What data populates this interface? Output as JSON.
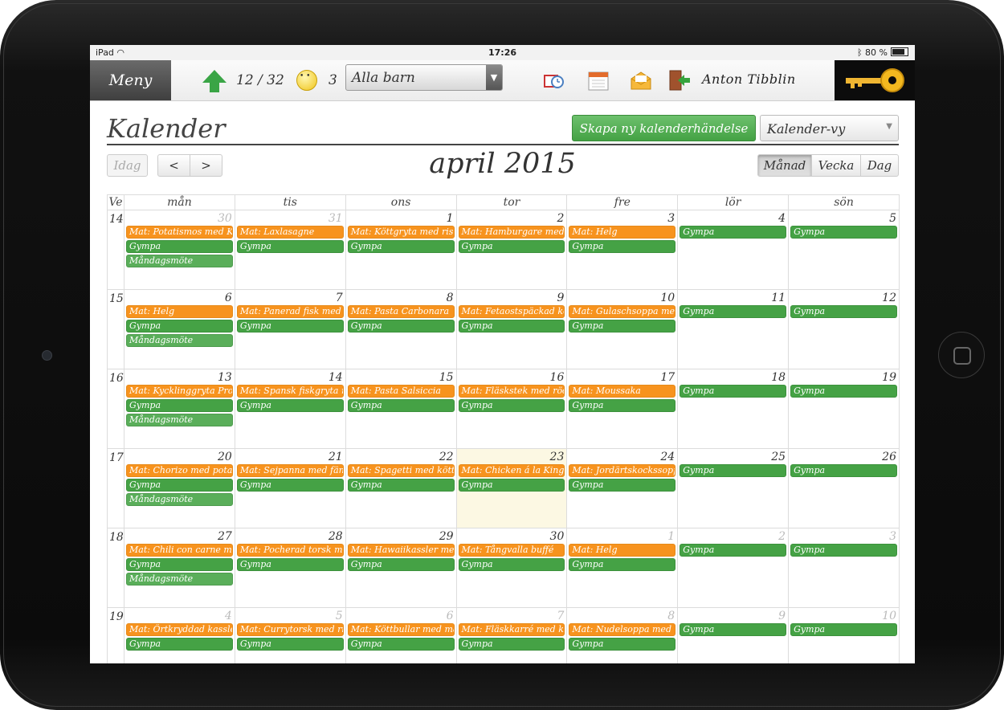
{
  "status": {
    "device": "iPad",
    "time": "17:26",
    "battery": "80 %"
  },
  "toolbar": {
    "menu_label": "Meny",
    "messages_count": "12 / 32",
    "notes_count": "3",
    "child_select_value": "Alla barn",
    "user_name": "Anton Tibblin"
  },
  "page": {
    "title": "Kalender",
    "create_button": "Skapa ny kalenderhändelse",
    "view_select": "Kalender-vy"
  },
  "nav": {
    "today": "Idag",
    "prev": "<",
    "next": ">",
    "month_title": "april 2015"
  },
  "views": {
    "month": "Månad",
    "week": "Vecka",
    "day": "Dag"
  },
  "calendar": {
    "week_header": "Ve",
    "day_headers": [
      "mån",
      "tis",
      "ons",
      "tor",
      "fre",
      "lör",
      "sön"
    ],
    "weeks": [
      {
        "week": "14",
        "days": [
          {
            "num": "30",
            "other": true,
            "events": [
              {
                "type": "mat",
                "text": "Mat: Potatismos med Korv"
              },
              {
                "type": "gym",
                "text": "Gympa"
              },
              {
                "type": "mote",
                "text": "Måndagsmöte"
              }
            ]
          },
          {
            "num": "31",
            "other": true,
            "events": [
              {
                "type": "mat",
                "text": "Mat: Laxlasagne"
              },
              {
                "type": "gym",
                "text": "Gympa"
              }
            ]
          },
          {
            "num": "1",
            "events": [
              {
                "type": "mat",
                "text": "Mat: Köttgryta med ris"
              },
              {
                "type": "gym",
                "text": "Gympa"
              }
            ]
          },
          {
            "num": "2",
            "events": [
              {
                "type": "mat",
                "text": "Mat: Hamburgare med tillbehör"
              },
              {
                "type": "gym",
                "text": "Gympa"
              }
            ]
          },
          {
            "num": "3",
            "events": [
              {
                "type": "mat",
                "text": "Mat: Helg"
              },
              {
                "type": "gym",
                "text": "Gympa"
              }
            ]
          },
          {
            "num": "4",
            "events": [
              {
                "type": "gym",
                "text": "Gympa"
              }
            ]
          },
          {
            "num": "5",
            "events": [
              {
                "type": "gym",
                "text": "Gympa"
              }
            ]
          }
        ]
      },
      {
        "week": "15",
        "days": [
          {
            "num": "6",
            "events": [
              {
                "type": "mat",
                "text": "Mat: Helg"
              },
              {
                "type": "gym",
                "text": "Gympa"
              },
              {
                "type": "mote",
                "text": "Måndagsmöte"
              }
            ]
          },
          {
            "num": "7",
            "events": [
              {
                "type": "mat",
                "text": "Mat: Panerad fisk med potatis"
              },
              {
                "type": "gym",
                "text": "Gympa"
              }
            ]
          },
          {
            "num": "8",
            "events": [
              {
                "type": "mat",
                "text": "Mat: Pasta Carbonara"
              },
              {
                "type": "gym",
                "text": "Gympa"
              }
            ]
          },
          {
            "num": "9",
            "events": [
              {
                "type": "mat",
                "text": "Mat: Fetaostspäckad köttfärslimpa"
              },
              {
                "type": "gym",
                "text": "Gympa"
              }
            ]
          },
          {
            "num": "10",
            "events": [
              {
                "type": "mat",
                "text": "Mat: Gulaschsoppa med bröd"
              },
              {
                "type": "gym",
                "text": "Gympa"
              }
            ]
          },
          {
            "num": "11",
            "events": [
              {
                "type": "gym",
                "text": "Gympa"
              }
            ]
          },
          {
            "num": "12",
            "events": [
              {
                "type": "gym",
                "text": "Gympa"
              }
            ]
          }
        ]
      },
      {
        "week": "16",
        "days": [
          {
            "num": "13",
            "events": [
              {
                "type": "mat",
                "text": "Mat: Kycklinggryta Provencale"
              },
              {
                "type": "gym",
                "text": "Gympa"
              },
              {
                "type": "mote",
                "text": "Måndagsmöte"
              }
            ]
          },
          {
            "num": "14",
            "events": [
              {
                "type": "mat",
                "text": "Mat: Spansk fiskgryta med ris"
              },
              {
                "type": "gym",
                "text": "Gympa"
              }
            ]
          },
          {
            "num": "15",
            "events": [
              {
                "type": "mat",
                "text": "Mat: Pasta Salsiccia"
              },
              {
                "type": "gym",
                "text": "Gympa"
              }
            ]
          },
          {
            "num": "16",
            "events": [
              {
                "type": "mat",
                "text": "Mat: Fläskstek med rödkål"
              },
              {
                "type": "gym",
                "text": "Gympa"
              }
            ]
          },
          {
            "num": "17",
            "events": [
              {
                "type": "mat",
                "text": "Mat: Moussaka"
              },
              {
                "type": "gym",
                "text": "Gympa"
              }
            ]
          },
          {
            "num": "18",
            "events": [
              {
                "type": "gym",
                "text": "Gympa"
              }
            ]
          },
          {
            "num": "19",
            "events": [
              {
                "type": "gym",
                "text": "Gympa"
              }
            ]
          }
        ]
      },
      {
        "week": "17",
        "days": [
          {
            "num": "20",
            "events": [
              {
                "type": "mat",
                "text": "Mat: Chorizo med potatis"
              },
              {
                "type": "gym",
                "text": "Gympa"
              },
              {
                "type": "mote",
                "text": "Måndagsmöte"
              }
            ]
          },
          {
            "num": "21",
            "events": [
              {
                "type": "mat",
                "text": "Mat: Sejpanna med fänkål"
              },
              {
                "type": "gym",
                "text": "Gympa"
              }
            ]
          },
          {
            "num": "22",
            "events": [
              {
                "type": "mat",
                "text": "Mat: Spagetti med köttfärssås"
              },
              {
                "type": "gym",
                "text": "Gympa"
              }
            ]
          },
          {
            "num": "23",
            "today": true,
            "events": [
              {
                "type": "mat",
                "text": "Mat: Chicken á la King med ris"
              },
              {
                "type": "gym",
                "text": "Gympa"
              }
            ]
          },
          {
            "num": "24",
            "events": [
              {
                "type": "mat",
                "text": "Mat: Jordärtskockssoppa"
              },
              {
                "type": "gym",
                "text": "Gympa"
              }
            ]
          },
          {
            "num": "25",
            "events": [
              {
                "type": "gym",
                "text": "Gympa"
              }
            ]
          },
          {
            "num": "26",
            "events": [
              {
                "type": "gym",
                "text": "Gympa"
              }
            ]
          }
        ]
      },
      {
        "week": "18",
        "days": [
          {
            "num": "27",
            "events": [
              {
                "type": "mat",
                "text": "Mat: Chili con carne med ris"
              },
              {
                "type": "gym",
                "text": "Gympa"
              },
              {
                "type": "mote",
                "text": "Måndagsmöte"
              }
            ]
          },
          {
            "num": "28",
            "events": [
              {
                "type": "mat",
                "text": "Mat: Pocherad torsk med potatis"
              },
              {
                "type": "gym",
                "text": "Gympa"
              }
            ]
          },
          {
            "num": "29",
            "events": [
              {
                "type": "mat",
                "text": "Mat: Hawaiikassler med ris"
              },
              {
                "type": "gym",
                "text": "Gympa"
              }
            ]
          },
          {
            "num": "30",
            "events": [
              {
                "type": "mat",
                "text": "Mat: Tångvalla buffé"
              },
              {
                "type": "gym",
                "text": "Gympa"
              }
            ]
          },
          {
            "num": "1",
            "other": true,
            "events": [
              {
                "type": "mat",
                "text": "Mat: Helg"
              },
              {
                "type": "gym",
                "text": "Gympa"
              }
            ]
          },
          {
            "num": "2",
            "other": true,
            "events": [
              {
                "type": "gym",
                "text": "Gympa"
              }
            ]
          },
          {
            "num": "3",
            "other": true,
            "events": [
              {
                "type": "gym",
                "text": "Gympa"
              }
            ]
          }
        ]
      },
      {
        "week": "19",
        "days": [
          {
            "num": "4",
            "other": true,
            "events": [
              {
                "type": "mat",
                "text": "Mat: Örtkryddad kassler"
              },
              {
                "type": "gym",
                "text": "Gympa"
              }
            ]
          },
          {
            "num": "5",
            "other": true,
            "events": [
              {
                "type": "mat",
                "text": "Mat: Currytorsk med ris"
              },
              {
                "type": "gym",
                "text": "Gympa"
              }
            ]
          },
          {
            "num": "6",
            "other": true,
            "events": [
              {
                "type": "mat",
                "text": "Mat: Köttbullar med makaroner"
              },
              {
                "type": "gym",
                "text": "Gympa"
              }
            ]
          },
          {
            "num": "7",
            "other": true,
            "events": [
              {
                "type": "mat",
                "text": "Mat: Fläskkarré med klyftpotatis"
              },
              {
                "type": "gym",
                "text": "Gympa"
              }
            ]
          },
          {
            "num": "8",
            "other": true,
            "events": [
              {
                "type": "mat",
                "text": "Mat: Nudelsoppa med bröd"
              },
              {
                "type": "gym",
                "text": "Gympa"
              }
            ]
          },
          {
            "num": "9",
            "other": true,
            "events": [
              {
                "type": "gym",
                "text": "Gympa"
              }
            ]
          },
          {
            "num": "10",
            "other": true,
            "events": [
              {
                "type": "gym",
                "text": "Gympa"
              }
            ]
          }
        ]
      }
    ]
  },
  "colors": {
    "food_event": "#f7931e",
    "gym_event": "#45a245",
    "meeting_event": "#5aae5a",
    "today_bg": "#fcf8e3",
    "create_button": "#55b055"
  }
}
